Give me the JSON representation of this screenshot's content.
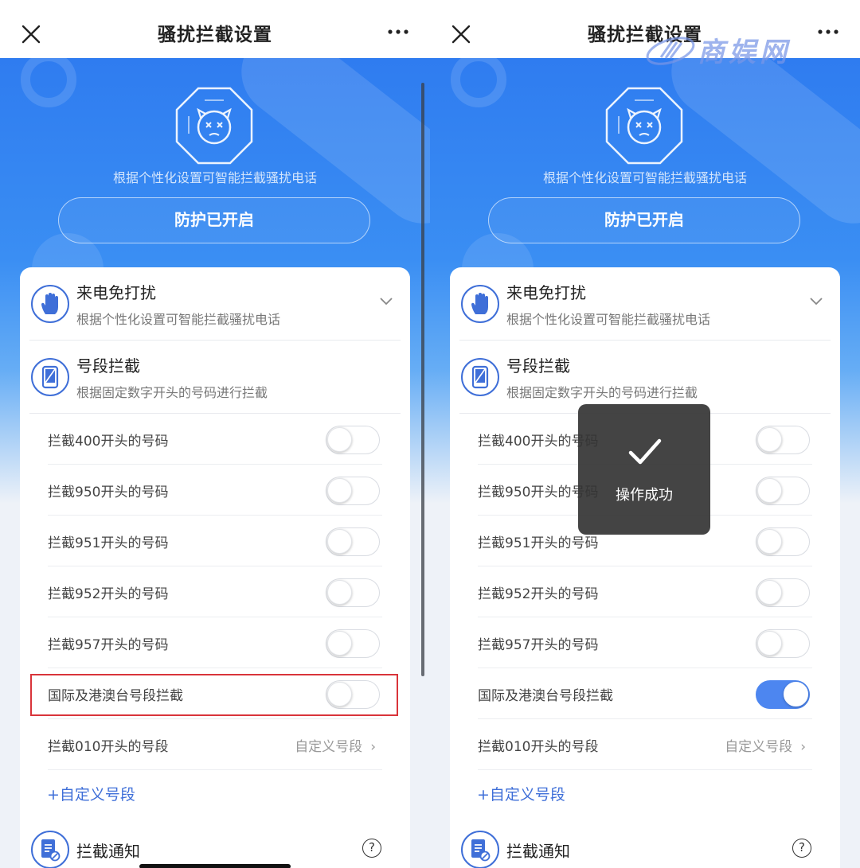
{
  "left": {
    "nav": {
      "title": "骚扰拦截设置"
    },
    "hero": {
      "subtitle": "根据个性化设置可智能拦截骚扰电话",
      "status_button": "防护已开启"
    },
    "sections": [
      {
        "title": "来电免打扰",
        "desc": "根据个性化设置可智能拦截骚扰电话"
      },
      {
        "title": "号段拦截",
        "desc": "根据固定数字开头的号码进行拦截"
      }
    ],
    "rows": [
      {
        "label": "拦截400开头的号码"
      },
      {
        "label": "拦截950开头的号码"
      },
      {
        "label": "拦截951开头的号码"
      },
      {
        "label": "拦截952开头的号码"
      },
      {
        "label": "拦截957开头的号码"
      },
      {
        "label": "国际及港澳台号段拦截"
      }
    ],
    "custom_row": {
      "label": "拦截010开头的号段",
      "aside": "自定义号段"
    },
    "add_link": "+自定义号段",
    "notice": {
      "title": "拦截通知",
      "help": "?"
    }
  },
  "right": {
    "nav": {
      "title": "骚扰拦截设置"
    },
    "hero": {
      "subtitle": "根据个性化设置可智能拦截骚扰电话",
      "status_button": "防护已开启"
    },
    "sections": [
      {
        "title": "来电免打扰",
        "desc": "根据个性化设置可智能拦截骚扰电话"
      },
      {
        "title": "号段拦截",
        "desc": "根据固定数字开头的号码进行拦截"
      }
    ],
    "rows": [
      {
        "label": "拦截400开头的号码"
      },
      {
        "label": "拦截950开头的号码"
      },
      {
        "label": "拦截951开头的号码"
      },
      {
        "label": "拦截952开头的号码"
      },
      {
        "label": "拦截957开头的号码"
      },
      {
        "label": "国际及港澳台号段拦截"
      }
    ],
    "custom_row": {
      "label": "拦截010开头的号段",
      "aside": "自定义号段"
    },
    "add_link": "+自定义号段",
    "notice": {
      "title": "拦截通知",
      "help": "?"
    },
    "toast": {
      "message": "操作成功"
    }
  },
  "watermark": {
    "text": "商娱网"
  },
  "toggle_states": {
    "left": [
      false,
      false,
      false,
      false,
      false,
      false
    ],
    "right": [
      false,
      false,
      false,
      false,
      false,
      true
    ]
  },
  "colors": {
    "accent": "#4d86f0",
    "highlight_border": "#d9343a",
    "hero_blue": "#2f7cf0"
  }
}
